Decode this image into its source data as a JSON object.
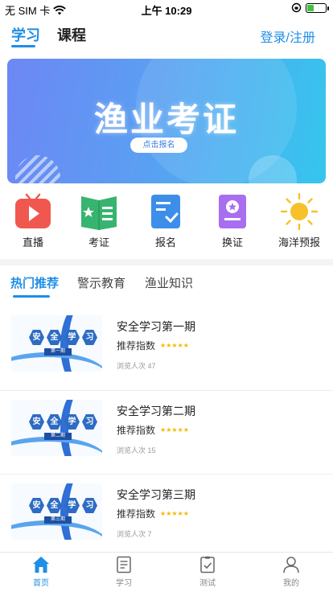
{
  "status_bar": {
    "carrier": "无 SIM 卡",
    "time": "上午 10:29",
    "battery_level": 0.35
  },
  "top_nav": {
    "tabs": [
      {
        "label": "学习",
        "active": true
      },
      {
        "label": "课程",
        "active": false
      }
    ],
    "login_label": "登录/注册"
  },
  "banner": {
    "title": "渔业考证",
    "button_label": "点击报名"
  },
  "quick_menu": [
    {
      "label": "直播",
      "icon": "tv-play-icon"
    },
    {
      "label": "考证",
      "icon": "book-icon"
    },
    {
      "label": "报名",
      "icon": "checklist-icon"
    },
    {
      "label": "换证",
      "icon": "certificate-icon"
    },
    {
      "label": "海洋预报",
      "icon": "sun-icon"
    }
  ],
  "category_tabs": [
    {
      "label": "热门推荐",
      "active": true
    },
    {
      "label": "警示教育",
      "active": false
    },
    {
      "label": "渔业知识",
      "active": false
    }
  ],
  "courses": [
    {
      "title": "安全学习第一期",
      "rec_label": "推荐指数",
      "stars": "★★★★★",
      "views": "浏览人次 47",
      "thumb_chars": [
        "安",
        "全",
        "学",
        "习"
      ],
      "thumb_period": "第一期"
    },
    {
      "title": "安全学习第二期",
      "rec_label": "推荐指数",
      "stars": "★★★★★",
      "views": "浏览人次 15",
      "thumb_chars": [
        "安",
        "全",
        "学",
        "习"
      ],
      "thumb_period": "第二期"
    },
    {
      "title": "安全学习第三期",
      "rec_label": "推荐指数",
      "stars": "★★★★★",
      "views": "浏览人次 7",
      "thumb_chars": [
        "安",
        "全",
        "学",
        "习"
      ],
      "thumb_period": "第三期"
    }
  ],
  "bottom_nav": [
    {
      "label": "首页",
      "icon": "home-icon",
      "active": true
    },
    {
      "label": "学习",
      "icon": "document-icon",
      "active": false
    },
    {
      "label": "测试",
      "icon": "test-icon",
      "active": false
    },
    {
      "label": "我的",
      "icon": "profile-icon",
      "active": false
    }
  ],
  "colors": {
    "accent": "#1f8ee6",
    "star": "#f5b800"
  }
}
